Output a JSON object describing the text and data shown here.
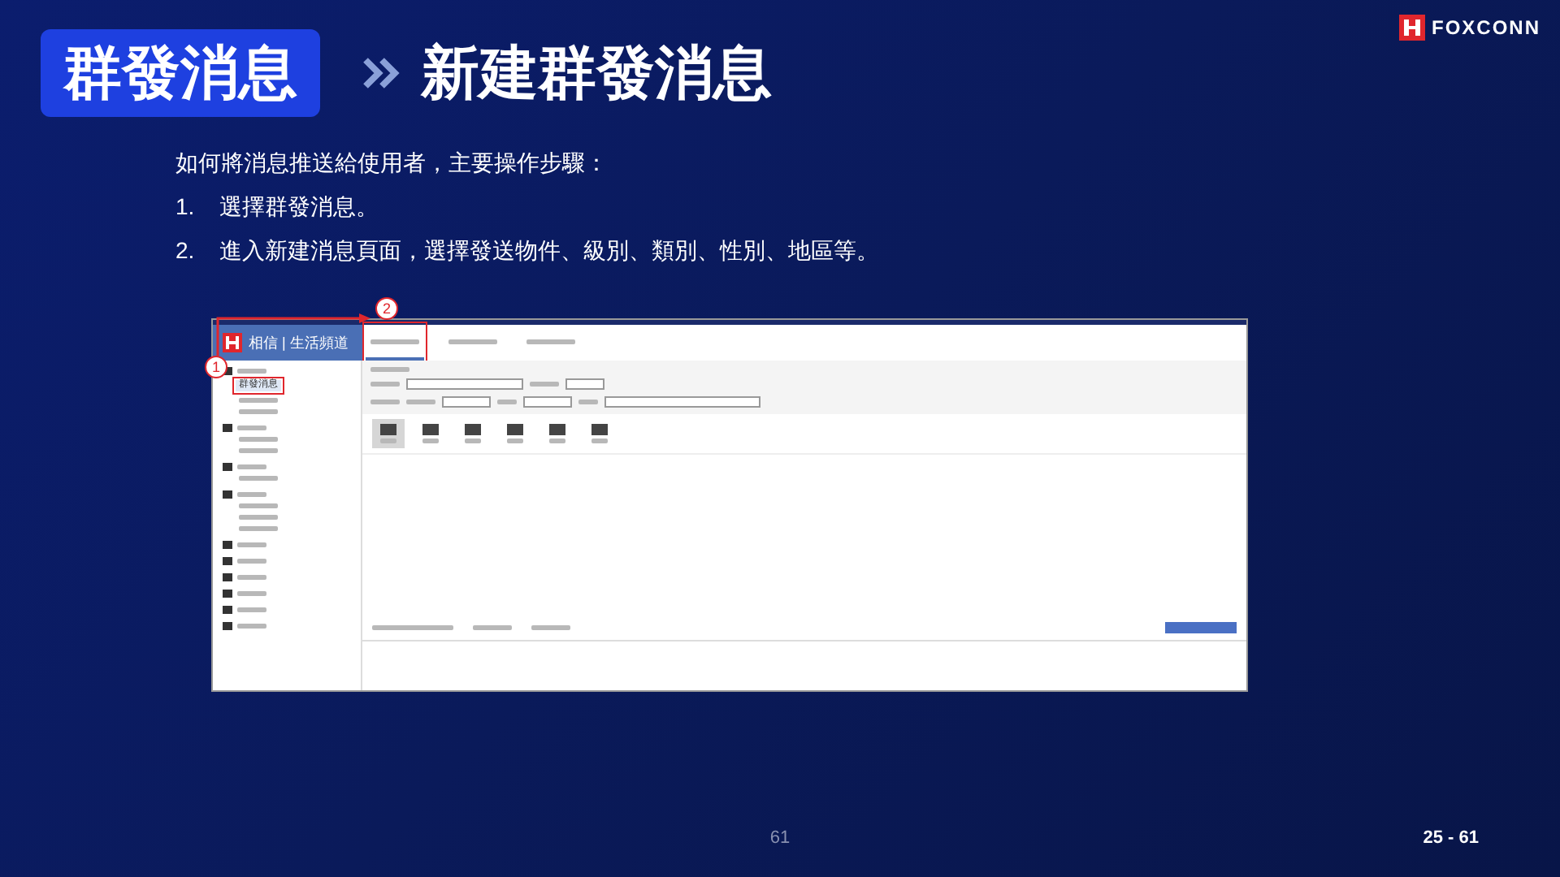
{
  "header": {
    "tag": "群發消息",
    "title": "新建群發消息"
  },
  "logo": {
    "name": "FOXCONN"
  },
  "intro": "如何將消息推送給使用者，主要操作步驟：",
  "steps": [
    {
      "number": "1.",
      "text": "選擇群發消息。"
    },
    {
      "number": "2.",
      "text": "進入新建消息頁面，選擇發送物件、級別、類別、性別、地區等。"
    }
  ],
  "screenshot": {
    "brand": "相信 | 生活頻道",
    "sidebar_item": {
      "label": "群發消息",
      "selected": true
    },
    "tabs": [
      {
        "selected": true
      },
      {
        "selected": false
      },
      {
        "selected": false
      }
    ],
    "media_types": [
      {
        "selected": true
      },
      {
        "selected": false
      },
      {
        "selected": false
      },
      {
        "selected": false
      },
      {
        "selected": false
      },
      {
        "selected": false
      }
    ],
    "callouts": [
      "1",
      "2"
    ]
  },
  "footer": {
    "page": "61",
    "range": "25 - 61"
  }
}
